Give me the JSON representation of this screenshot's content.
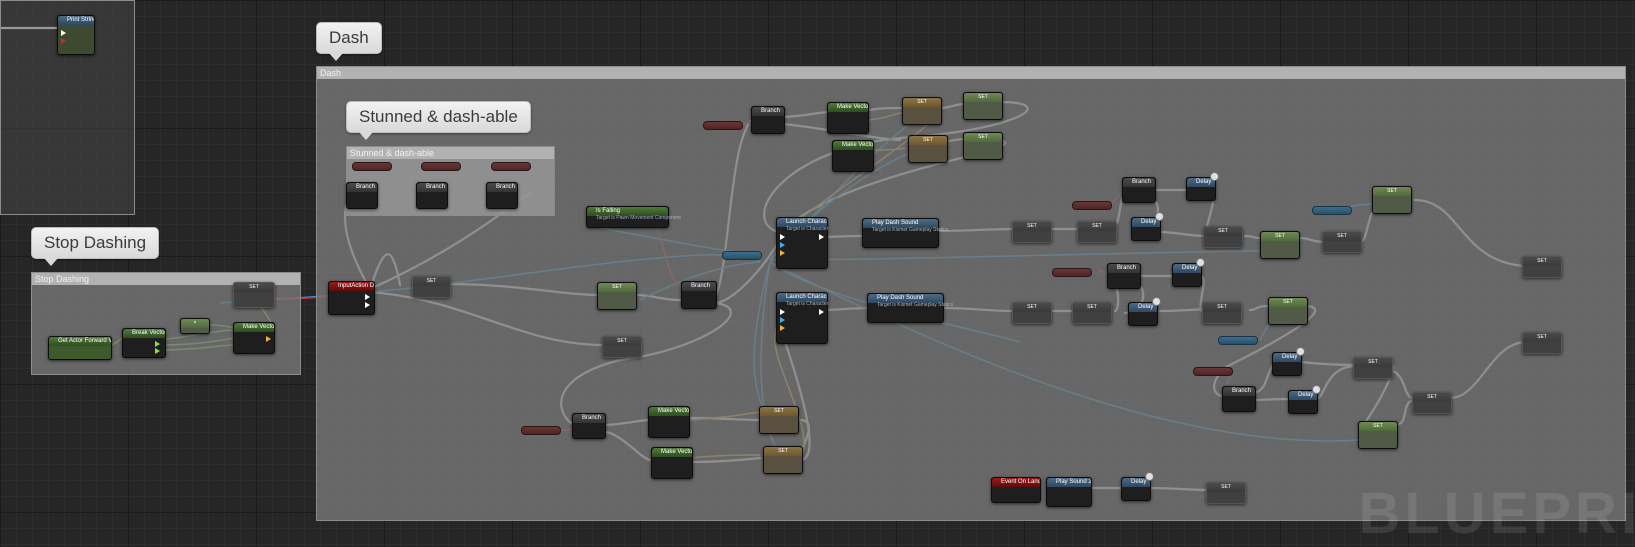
{
  "comments": {
    "top_left_node": "Print String",
    "dash": "Dash",
    "stunned": "Stunned & dash-able",
    "stop_dashing": "Stop Dashing"
  },
  "bubbles": {
    "dash": "Dash",
    "stunned": "Stunned & dash-able",
    "stop_dashing": "Stop Dashing"
  },
  "nodes": {
    "print_string": "Print String",
    "branch": "Branch",
    "set": "SET",
    "input_action_dash": "InputAction Dash",
    "get_actor_forward_vector": "Get Actor Forward Vector",
    "break_vector": "Break Vector",
    "make_vector": "Make Vector",
    "is_falling": "Is Falling",
    "is_falling_sub": "Target is Pawn Movement Component",
    "launch_character": "Launch Character",
    "launch_character_sub": "Target is Character",
    "play_sound": "Play Dash Sound",
    "play_sound_sub": "Target is Kismet Gameplay Statics",
    "delay": "Delay",
    "event_on_landed": "Event On Landed",
    "play_sound_2d": "Play Sound 2D"
  },
  "watermark": "BLUEPRI"
}
